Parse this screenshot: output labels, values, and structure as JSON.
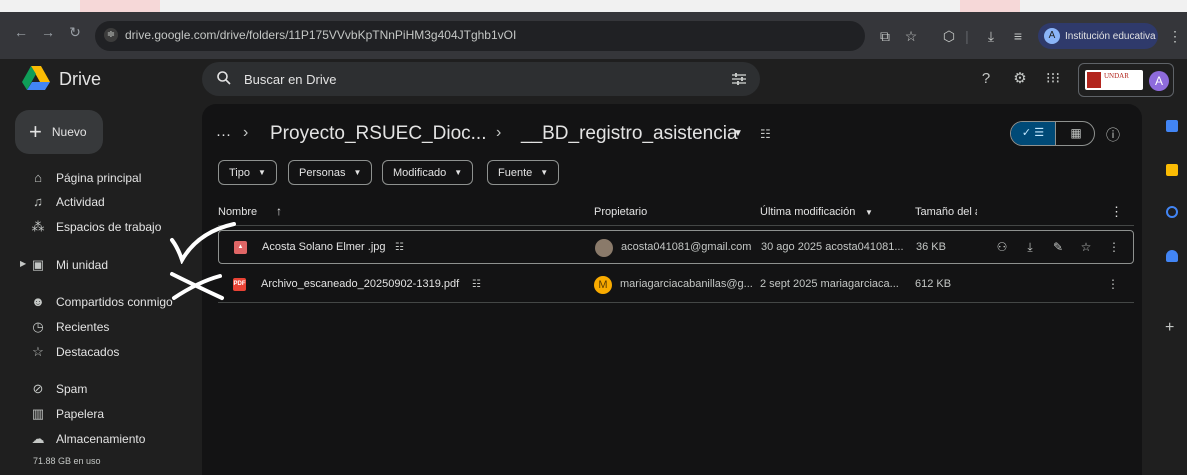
{
  "browser": {
    "url": "drive.google.com/drive/folders/11P175VVvbKpTNnPiHM3g404JTghb1vOI",
    "profile_initial": "A",
    "profile_name": "Institución educativa"
  },
  "app": {
    "title": "Drive",
    "search_placeholder": "Buscar en Drive",
    "org_logo_text": "UNDAR",
    "account_initial": "A"
  },
  "sidebar": {
    "new_label": "Nuevo",
    "items": [
      {
        "label": "Página principal",
        "icon": "home-icon"
      },
      {
        "label": "Actividad",
        "icon": "bell-icon"
      },
      {
        "label": "Espacios de trabajo",
        "icon": "workspaces-icon"
      },
      {
        "label": "Mi unidad",
        "icon": "drive-icon"
      },
      {
        "label": "Compartidos conmigo",
        "icon": "people-icon"
      },
      {
        "label": "Recientes",
        "icon": "clock-icon"
      },
      {
        "label": "Destacados",
        "icon": "star-icon"
      },
      {
        "label": "Spam",
        "icon": "spam-icon"
      },
      {
        "label": "Papelera",
        "icon": "trash-icon"
      },
      {
        "label": "Almacenamiento",
        "icon": "cloud-icon"
      }
    ],
    "storage_used": "71.88 GB en uso"
  },
  "breadcrumb": {
    "more": "···",
    "parent": "Proyecto_RSUEC_Dioc...",
    "current": "__BD_registro_asistencia"
  },
  "filters": [
    "Tipo",
    "Personas",
    "Modificado",
    "Fuente"
  ],
  "table": {
    "headers": {
      "name": "Nombre",
      "owner": "Propietario",
      "modified": "Última modificación",
      "size": "Tamaño del a"
    },
    "rows": [
      {
        "name": "Acosta Solano Elmer .jpg",
        "type": "image",
        "owner": "acosta041081@gmail.com",
        "modified": "30 ago 2025 acosta041081...",
        "size": "36 KB",
        "color": "#e06666"
      },
      {
        "name": "Archivo_escaneado_20250902-1319.pdf",
        "type": "pdf",
        "owner_initial": "M",
        "owner": "mariagarciacabanillas@g...",
        "modified": "2 sept 2025 mariagarciaca...",
        "size": "612 KB",
        "color": "#ea4335"
      }
    ]
  },
  "colors": {
    "accent": "#004a77",
    "background": "#131314"
  }
}
